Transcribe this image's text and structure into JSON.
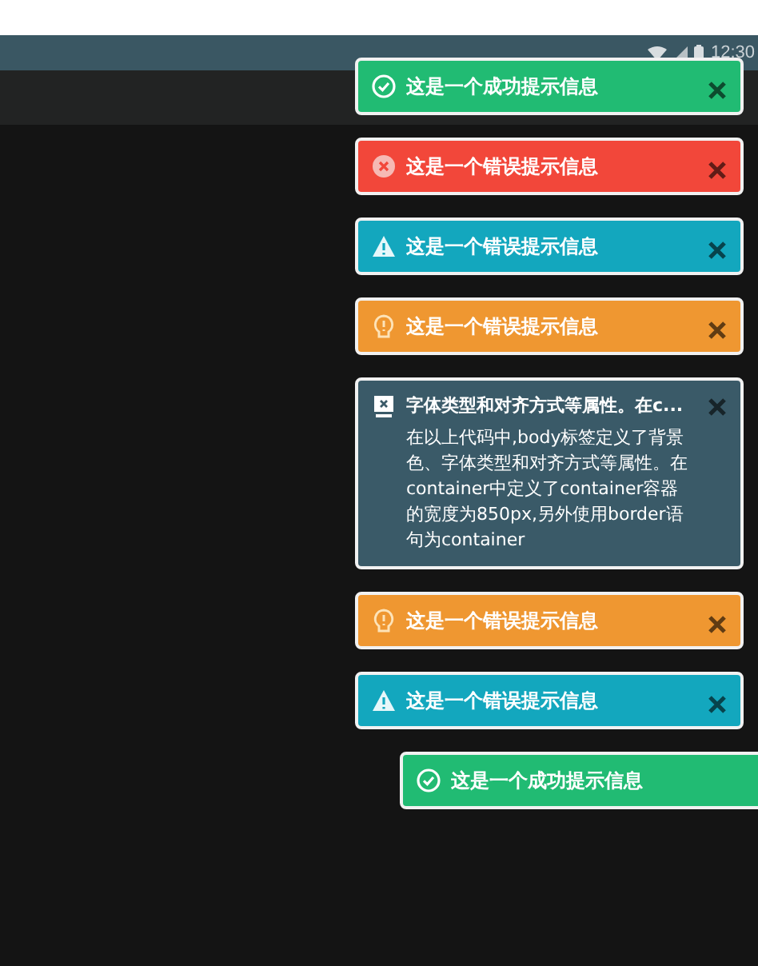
{
  "status_bar": {
    "time": "12:30"
  },
  "toasts": [
    {
      "kind": "success",
      "title": "这是一个成功提示信息",
      "closable": true,
      "sliding": false
    },
    {
      "kind": "error",
      "title": "这是一个错误提示信息",
      "closable": true,
      "sliding": false
    },
    {
      "kind": "info",
      "title": "这是一个错误提示信息",
      "closable": true,
      "sliding": false
    },
    {
      "kind": "warning",
      "title": "这是一个错误提示信息",
      "closable": true,
      "sliding": false
    },
    {
      "kind": "notice",
      "title": "字体类型和对齐方式等属性。在c...",
      "body": "在以上代码中,body标签定义了背景色、字体类型和对齐方式等属性。在container中定义了container容器的宽度为850px,另外使用border语句为container",
      "closable": true,
      "sliding": false
    },
    {
      "kind": "warning",
      "title": "这是一个错误提示信息",
      "closable": true,
      "sliding": false
    },
    {
      "kind": "info",
      "title": "这是一个错误提示信息",
      "closable": true,
      "sliding": false
    },
    {
      "kind": "success",
      "title": "这是一个成功提示信息",
      "closable": false,
      "sliding": true
    }
  ]
}
